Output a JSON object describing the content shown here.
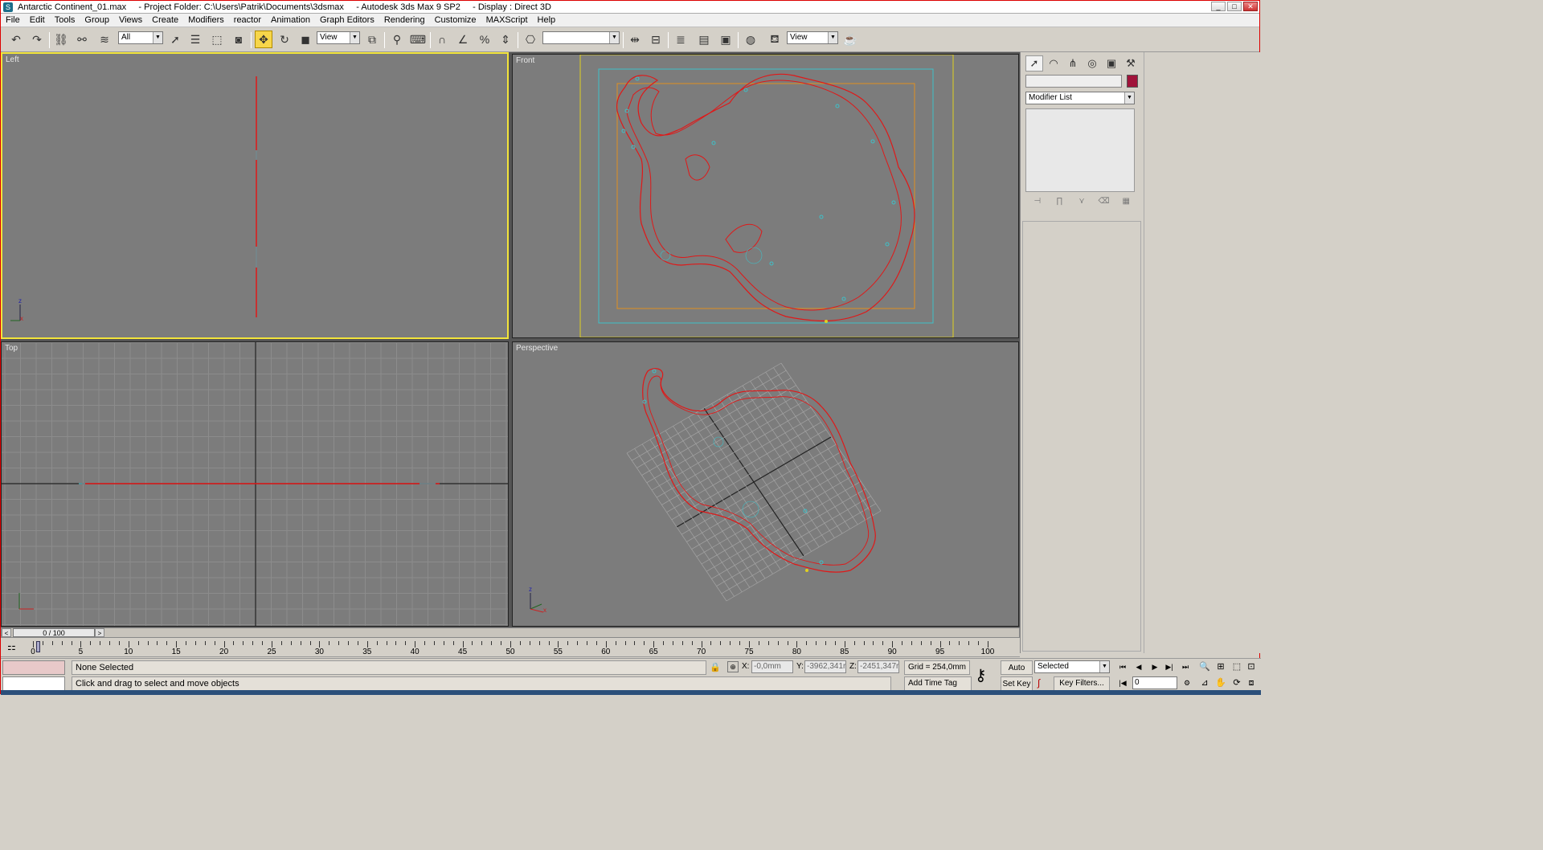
{
  "window": {
    "title": "Antarctic Continent_01.max     - Project Folder: C:\\Users\\Patrik\\Documents\\3dsmax     - Autodesk 3ds Max 9 SP2     - Display : Direct 3D",
    "buttons": {
      "minimize": "_",
      "maximize": "□",
      "close": "✕"
    }
  },
  "menu": [
    "File",
    "Edit",
    "Tools",
    "Group",
    "Views",
    "Create",
    "Modifiers",
    "reactor",
    "Animation",
    "Graph Editors",
    "Rendering",
    "Customize",
    "MAXScript",
    "Help"
  ],
  "toolbar": {
    "selection_filter": "All",
    "reference_coord": "View",
    "named_selection": "",
    "render_view": "View"
  },
  "viewports": {
    "left": "Left",
    "front": "Front",
    "top": "Top",
    "perspective": "Perspective"
  },
  "command_panel": {
    "modifier_list": "Modifier List",
    "object_color": "#a0133a"
  },
  "timeline": {
    "slider": "0 / 100",
    "ticks": [
      "0",
      "5",
      "10",
      "15",
      "20",
      "25",
      "30",
      "35",
      "40",
      "45",
      "50",
      "55",
      "60",
      "65",
      "70",
      "75",
      "80",
      "85",
      "90",
      "95",
      "100"
    ]
  },
  "status": {
    "selection": "None Selected",
    "prompt": "Click and drag to select and move objects",
    "x_label": "X:",
    "x_value": "-0,0mm",
    "y_label": "Y:",
    "y_value": "-3962,341r",
    "z_label": "Z:",
    "z_value": "-2451,347r",
    "grid": "Grid = 254,0mm",
    "add_time_tag": "Add Time Tag",
    "auto_key": "Auto Key",
    "set_key": "Set Key",
    "key_mode": "Selected",
    "key_filters": "Key Filters...",
    "current_frame": "0"
  }
}
